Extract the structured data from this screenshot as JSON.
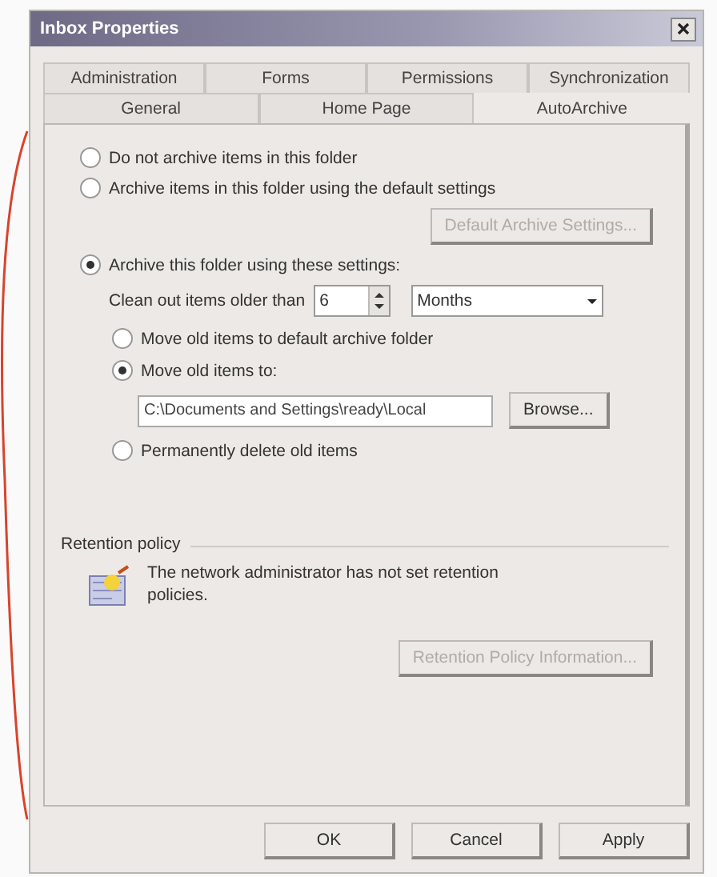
{
  "window": {
    "title": "Inbox Properties"
  },
  "tab_rows": [
    [
      {
        "label": "Administration",
        "selected": false
      },
      {
        "label": "Forms",
        "selected": false
      },
      {
        "label": "Permissions",
        "selected": false
      },
      {
        "label": "Synchronization",
        "selected": false
      }
    ],
    [
      {
        "label": "General",
        "selected": false
      },
      {
        "label": "Home Page",
        "selected": false
      },
      {
        "label": "AutoArchive",
        "selected": true
      }
    ]
  ],
  "archive_options": [
    {
      "label": "Do not archive items in this folder",
      "selected": false
    },
    {
      "label": "Archive items in this folder using the default settings",
      "selected": false
    },
    {
      "label": "Archive this folder using these settings:",
      "selected": true
    }
  ],
  "default_settings_button": {
    "label": "Default Archive Settings...",
    "disabled": true
  },
  "clean_out": {
    "label": "Clean out items older than",
    "value": "6",
    "unit": "Months"
  },
  "move_options": [
    {
      "label": "Move old items to default archive folder",
      "selected": false
    },
    {
      "label": "Move old items to:",
      "selected": true
    },
    {
      "label": "Permanently delete old items",
      "selected": false
    }
  ],
  "path_field": {
    "value": "C:\\Documents and Settings\\ready\\Local"
  },
  "browse_button": {
    "label": "Browse...",
    "disabled": false
  },
  "retention": {
    "heading": "Retention policy",
    "message": "The network administrator has not set retention policies.",
    "button": {
      "label": "Retention Policy Information...",
      "disabled": true
    }
  },
  "footer_buttons": [
    {
      "label": "OK",
      "disabled": false
    },
    {
      "label": "Cancel",
      "disabled": false
    },
    {
      "label": "Apply",
      "disabled": false
    }
  ]
}
